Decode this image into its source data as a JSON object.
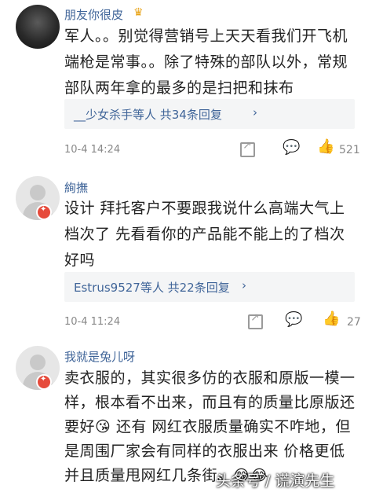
{
  "comments": [
    {
      "username": "朋友你很皮",
      "vip_badge": "♛",
      "lines": [
        "军人。。别觉得营销号上天天看我们开飞机",
        "端枪是常事。。除了特殊的部队以外，常规",
        "部队两年拿的最多的是扫把和抹布"
      ],
      "reply_text": "__少女杀手等人  共34条回复",
      "time": "10-4 14:24",
      "likes": "521"
    },
    {
      "username": "絢撫",
      "lines": [
        "设计 拜托客户不要跟我说什么高端大气上",
        "档次了 先看看你的产品能不能上的了档次",
        "好吗"
      ],
      "reply_text": "Estrus9527等人  共22条回复",
      "time": "10-4 11:24",
      "likes": "27"
    },
    {
      "username": "我就是兔儿呀",
      "lines": [
        "卖衣服的，其实很多仿的衣服和原版一模一",
        "样，根本看不出来，而且有的质量比原版还",
        "要好😘 还有 网红衣服质量确实不咋地，但",
        "是周围厂家会有同样的衣服出来 价格更低",
        "并且质量甩网红几条街。😂😂"
      ]
    }
  ],
  "watermark": "头条号 / 谎演先生",
  "icons": {
    "chevron": "›",
    "like": "👍",
    "reply": "💬",
    "share": "share-icon"
  }
}
